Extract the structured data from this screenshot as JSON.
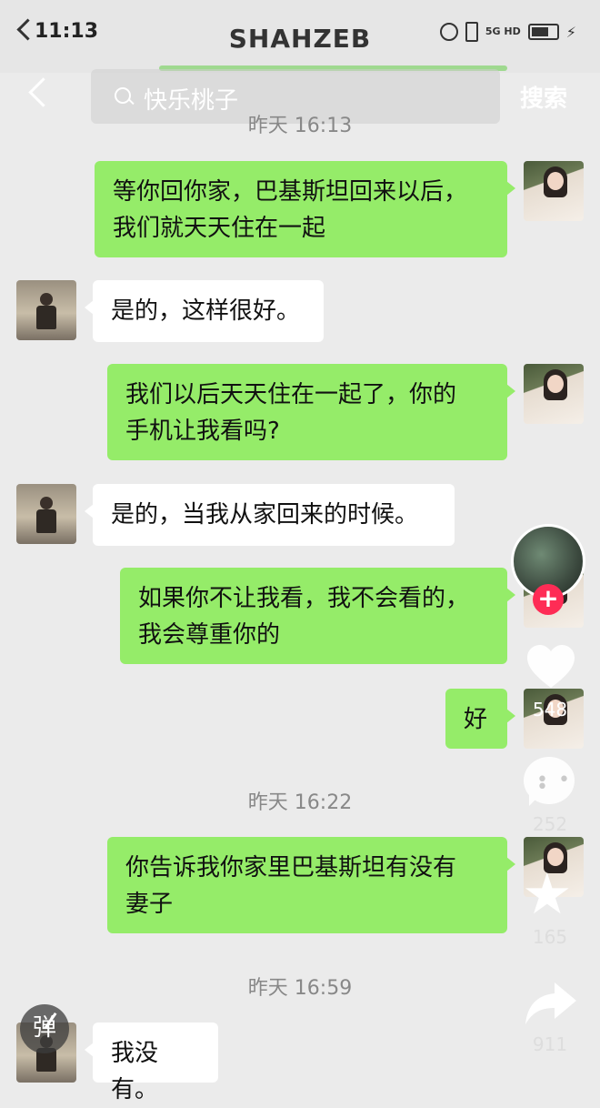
{
  "status_bar": {
    "time": "11:13",
    "title": "SHAHZEB",
    "network": "5G HD"
  },
  "search": {
    "query": "快乐桃子",
    "button": "搜索"
  },
  "timestamps": [
    "昨天 16:13",
    "昨天 16:22",
    "昨天 16:59"
  ],
  "messages": [
    {
      "side": "out",
      "lines": [
        "等你回你家，巴基斯坦回来以后，",
        "我们就天天住在一起"
      ]
    },
    {
      "side": "in",
      "lines": [
        "是的，这样很好。"
      ]
    },
    {
      "side": "out",
      "lines": [
        "我们以后天天住在一起了，你的",
        "手机让我看吗?"
      ]
    },
    {
      "side": "in",
      "lines": [
        "是的，当我从家回来的时候。"
      ]
    },
    {
      "side": "out",
      "lines": [
        "如果你不让我看，我不会看的，",
        "我会尊重你的"
      ]
    },
    {
      "side": "out",
      "lines": [
        "好"
      ]
    },
    {
      "side": "out",
      "lines": [
        "你告诉我你家里巴基斯坦有没有",
        "妻子"
      ]
    },
    {
      "side": "in",
      "lines": [
        "我没有。"
      ]
    }
  ],
  "sidebar": {
    "likes": "548",
    "comments": "252",
    "favorites": "165",
    "shares": "911",
    "plus": "+",
    "danmu": "弹"
  },
  "colors": {
    "out_bubble": "#95ec69",
    "in_bubble": "#ffffff",
    "accent": "#fe2c55"
  }
}
